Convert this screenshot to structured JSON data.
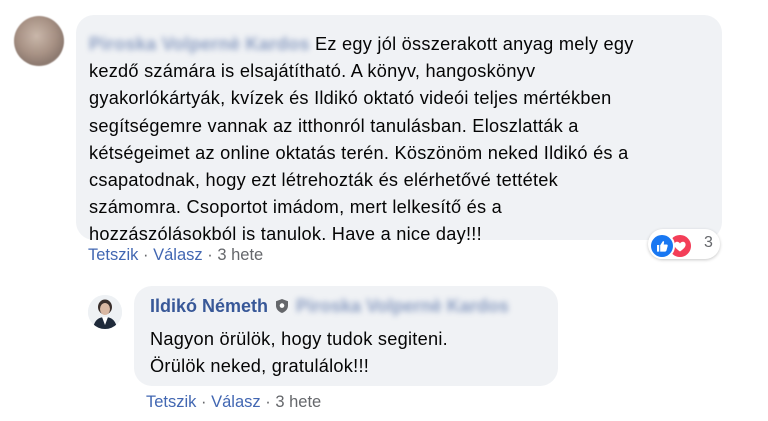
{
  "comment1": {
    "author_name": "Piroska Volpernè Kardos",
    "lines": [
      "Ez egy jól összerakott anyag mely egy",
      "kezdő számára is elsajátítható. A könyv, hangoskönyv",
      "gyakorlókártyák, kvízek és Ildikó oktató videói teljes mértékben",
      "segítségemre vannak az itthonról tanulásban. Eloszlatták a",
      "kétségeimet az online oktatás terén. Köszönöm neked Ildikó és a",
      "csapatodnak, hogy ezt létrehozták és elérhetővé tettétek",
      "számomra. Csoportot imádom, mert lelkesítő és a",
      "hozzászólásokból is tanulok. Have a nice day!!!"
    ],
    "actions": {
      "like": "Tetszik",
      "reply": "Válasz",
      "time": "3 hete",
      "separator": "·"
    },
    "reactions": {
      "count": "3",
      "types": [
        "like-icon",
        "love-icon"
      ]
    }
  },
  "comment2": {
    "author_name": "Ildikó Németh",
    "badge_icon": "top-fan-shield-icon",
    "tagged_name": "Piroska Volpernè Kardos",
    "lines": [
      "Nagyon örülök, hogy tudok segiteni.",
      "Örülök neked, gratulálok!!!"
    ],
    "actions": {
      "like": "Tetszik",
      "reply": "Válasz",
      "time": "3 hete",
      "separator": "·"
    }
  },
  "colors": {
    "bubble": "#f0f2f5",
    "name": "#385898",
    "action_link": "#4267b2",
    "meta": "#65676b",
    "like": "#1877f2",
    "love": "#f33e58"
  }
}
